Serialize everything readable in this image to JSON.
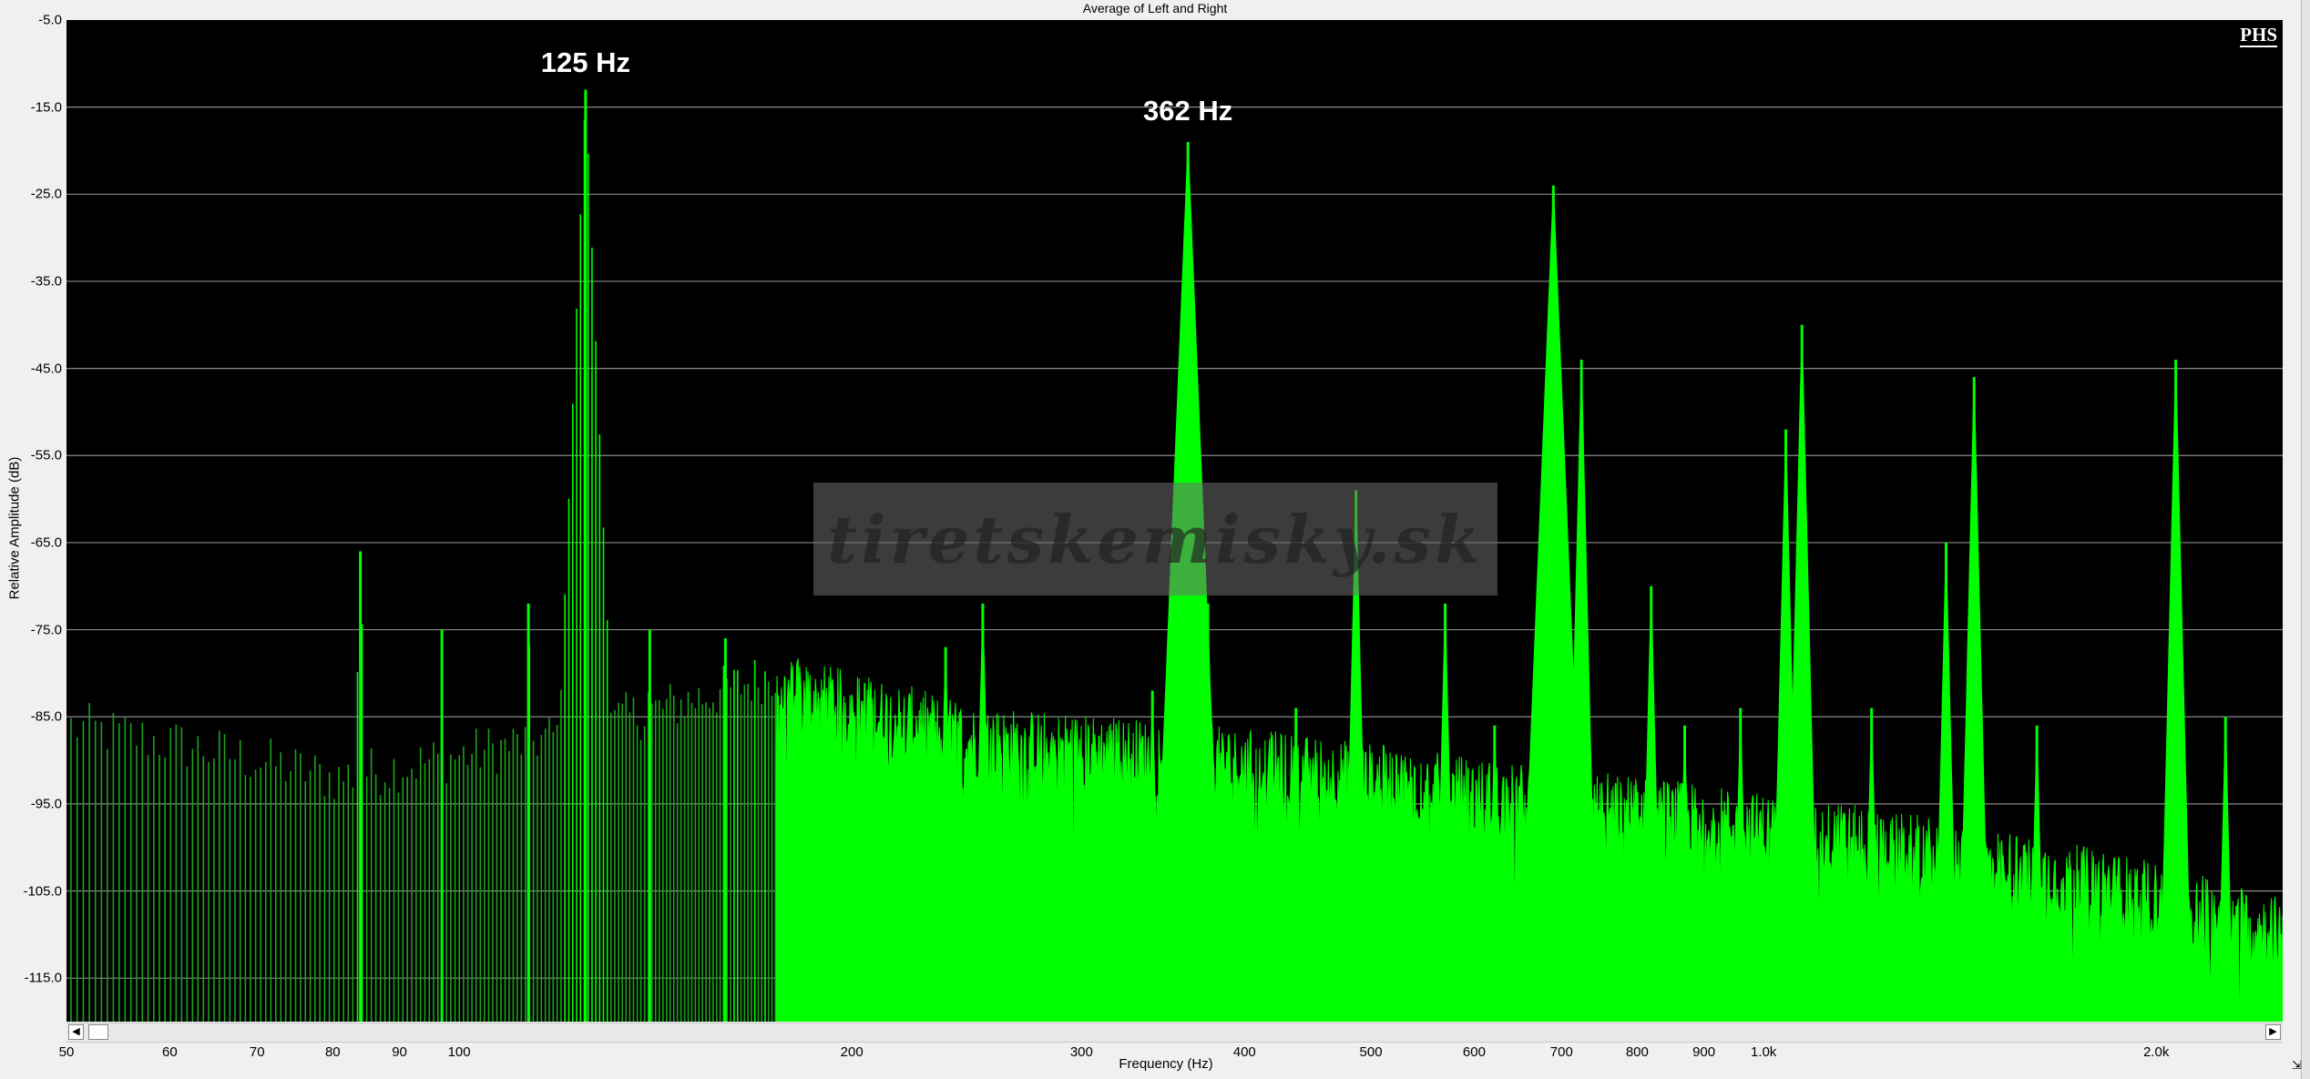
{
  "window": {
    "title": "Average of Left and Right",
    "logo_text": "PHS",
    "watermark_text": "tiretskemisky.sk",
    "corner_marker": "⇲"
  },
  "colors": {
    "background": "#000000",
    "trace": "#00ff00",
    "trace_dim": "#1aa31a",
    "grid": "#8a8a8a",
    "label": "#ffffff"
  },
  "chart_data": {
    "type": "area",
    "title": "Average of Left and Right",
    "xlabel": "Frequency (Hz)",
    "ylabel": "Relative Amplitude (dB)",
    "xscale": "log",
    "xlim": [
      50,
      2500
    ],
    "ylim": [
      -120,
      -5
    ],
    "grid": "horizontal",
    "y_ticks": [
      "-5.0",
      "-15.0",
      "-25.0",
      "-35.0",
      "-45.0",
      "-55.0",
      "-65.0",
      "-75.0",
      "-85.0",
      "-95.0",
      "-105.0",
      "-115.0"
    ],
    "x_ticks": [
      {
        "value": 50,
        "label": "50"
      },
      {
        "value": 60,
        "label": "60"
      },
      {
        "value": 70,
        "label": "70"
      },
      {
        "value": 80,
        "label": "80"
      },
      {
        "value": 90,
        "label": "90"
      },
      {
        "value": 100,
        "label": "100"
      },
      {
        "value": 200,
        "label": "200"
      },
      {
        "value": 300,
        "label": "300"
      },
      {
        "value": 400,
        "label": "400"
      },
      {
        "value": 500,
        "label": "500"
      },
      {
        "value": 600,
        "label": "600"
      },
      {
        "value": 700,
        "label": "700"
      },
      {
        "value": 800,
        "label": "800"
      },
      {
        "value": 900,
        "label": "900"
      },
      {
        "value": 1000,
        "label": "1.0k"
      },
      {
        "value": 2000,
        "label": "2.0k"
      }
    ],
    "annotations": [
      {
        "text": "125 Hz",
        "x": 125,
        "y": -13.5
      },
      {
        "text": "362 Hz",
        "x": 362,
        "y": -19
      }
    ],
    "series": [
      {
        "peaks": [
          {
            "x": 84,
            "y": -66
          },
          {
            "x": 97,
            "y": -75
          },
          {
            "x": 113,
            "y": -72
          },
          {
            "x": 125,
            "y": -13
          },
          {
            "x": 140,
            "y": -75
          },
          {
            "x": 160,
            "y": -76
          },
          {
            "x": 236,
            "y": -77
          },
          {
            "x": 252,
            "y": -72
          },
          {
            "x": 320,
            "y": -88
          },
          {
            "x": 340,
            "y": -82
          },
          {
            "x": 362,
            "y": -19
          },
          {
            "x": 375,
            "y": -72
          },
          {
            "x": 438,
            "y": -84
          },
          {
            "x": 487,
            "y": -59
          },
          {
            "x": 570,
            "y": -72
          },
          {
            "x": 622,
            "y": -86
          },
          {
            "x": 690,
            "y": -24
          },
          {
            "x": 725,
            "y": -44
          },
          {
            "x": 820,
            "y": -70
          },
          {
            "x": 870,
            "y": -86
          },
          {
            "x": 960,
            "y": -84
          },
          {
            "x": 1040,
            "y": -52
          },
          {
            "x": 1070,
            "y": -40
          },
          {
            "x": 1210,
            "y": -84
          },
          {
            "x": 1380,
            "y": -65
          },
          {
            "x": 1450,
            "y": -46
          },
          {
            "x": 1620,
            "y": -86
          },
          {
            "x": 2070,
            "y": -44
          },
          {
            "x": 2260,
            "y": -85
          }
        ]
      }
    ]
  }
}
